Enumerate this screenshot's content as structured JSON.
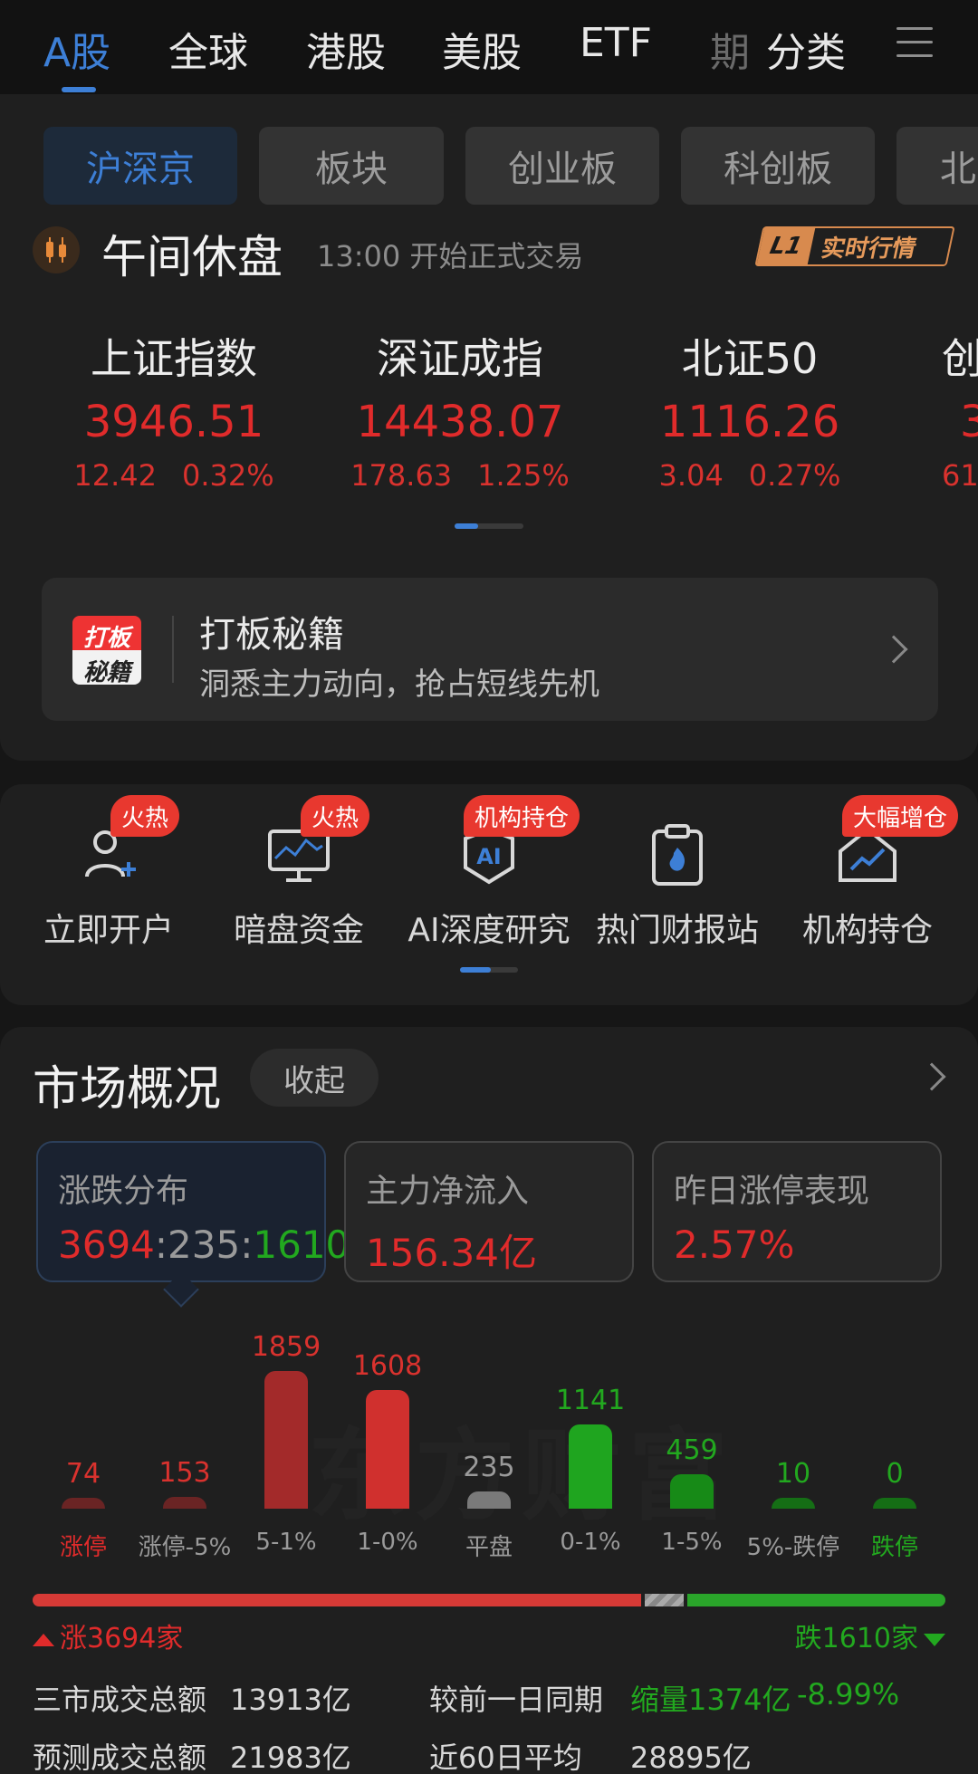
{
  "top_tabs": [
    "A股",
    "全球",
    "港股",
    "美股",
    "ETF",
    "期",
    "分类"
  ],
  "pills": [
    "沪深京",
    "板块",
    "创业板",
    "科创板",
    "北"
  ],
  "status": {
    "title": "午间休盘",
    "subtitle": "13:00  开始正式交易",
    "l1_badge": "L1",
    "l1_label": "实时行情"
  },
  "indices": [
    {
      "name": "上证指数",
      "value": "3946.51",
      "change": "12.42",
      "pct": "0.32%"
    },
    {
      "name": "深证成指",
      "value": "14438.07",
      "change": "178.63",
      "pct": "1.25%"
    },
    {
      "name": "北证50",
      "value": "1116.26",
      "change": "3.04",
      "pct": "0.27%"
    },
    {
      "name": "创",
      "value": "3",
      "change": "61.",
      "pct": ""
    }
  ],
  "promo": {
    "logo_top": "打板",
    "logo_bottom": "秘籍",
    "title": "打板秘籍",
    "subtitle": "洞悉主力动向，抢占短线先机"
  },
  "quick_entries": [
    {
      "label": "立即开户",
      "badge": "火热",
      "icon": "user-add-icon"
    },
    {
      "label": "暗盘资金",
      "badge": "火热",
      "icon": "monitor-chart-icon"
    },
    {
      "label": "AI深度研究",
      "badge": "机构持仓",
      "icon": "ai-shield-icon"
    },
    {
      "label": "热门财报站",
      "badge": "",
      "icon": "clipboard-fire-icon"
    },
    {
      "label": "机构持仓",
      "badge": "大幅增仓",
      "icon": "house-trend-icon"
    }
  ],
  "market": {
    "title": "市场概况",
    "collapse": "收起",
    "stats": [
      {
        "label": "涨跌分布",
        "up": "3694",
        "sep1": ":",
        "flat": "235",
        "sep2": ":",
        "down": "1610"
      },
      {
        "label": "主力净流入",
        "value": "156.34亿"
      },
      {
        "label": "昨日涨停表现",
        "value": "2.57%"
      }
    ],
    "watermark": "东方财富",
    "up_label": "涨3694家",
    "down_label": "跌1610家",
    "summary": {
      "r1_label": "三市成交总额",
      "r1_value": "13913亿",
      "r1_cmp_label": "较前一日同期",
      "r1_cmp_value": "缩量1374亿",
      "r1_cmp_pct": "-8.99%",
      "r2_label": "预测成交总额",
      "r2_value": "21983亿",
      "r2_cmp_label": "近60日平均",
      "r2_cmp_value": "28895亿"
    }
  },
  "chart_data": {
    "type": "bar",
    "categories": [
      "涨停",
      "涨停-5%",
      "5-1%",
      "1-0%",
      "平盘",
      "0-1%",
      "1-5%",
      "5%-跌停",
      "跌停"
    ],
    "values": [
      74,
      153,
      1859,
      1608,
      235,
      1141,
      459,
      10,
      0
    ],
    "colors": [
      "#6a2424",
      "#6a2424",
      "#a32a2a",
      "#d0302e",
      "#7a7a7a",
      "#1fa51f",
      "#178a17",
      "#156e15",
      "#156e15"
    ],
    "value_colors": [
      "#d9322e",
      "#d9322e",
      "#d9322e",
      "#d9322e",
      "#9a9a9a",
      "#22a81f",
      "#22a81f",
      "#22a81f",
      "#22a81f"
    ],
    "label_colors": [
      "#e02b2b",
      "#9a9a9a",
      "#9a9a9a",
      "#9a9a9a",
      "#9a9a9a",
      "#9a9a9a",
      "#9a9a9a",
      "#9a9a9a",
      "#22a81f"
    ],
    "distribution": {
      "up": 3694,
      "flat": 235,
      "down": 1610
    }
  }
}
